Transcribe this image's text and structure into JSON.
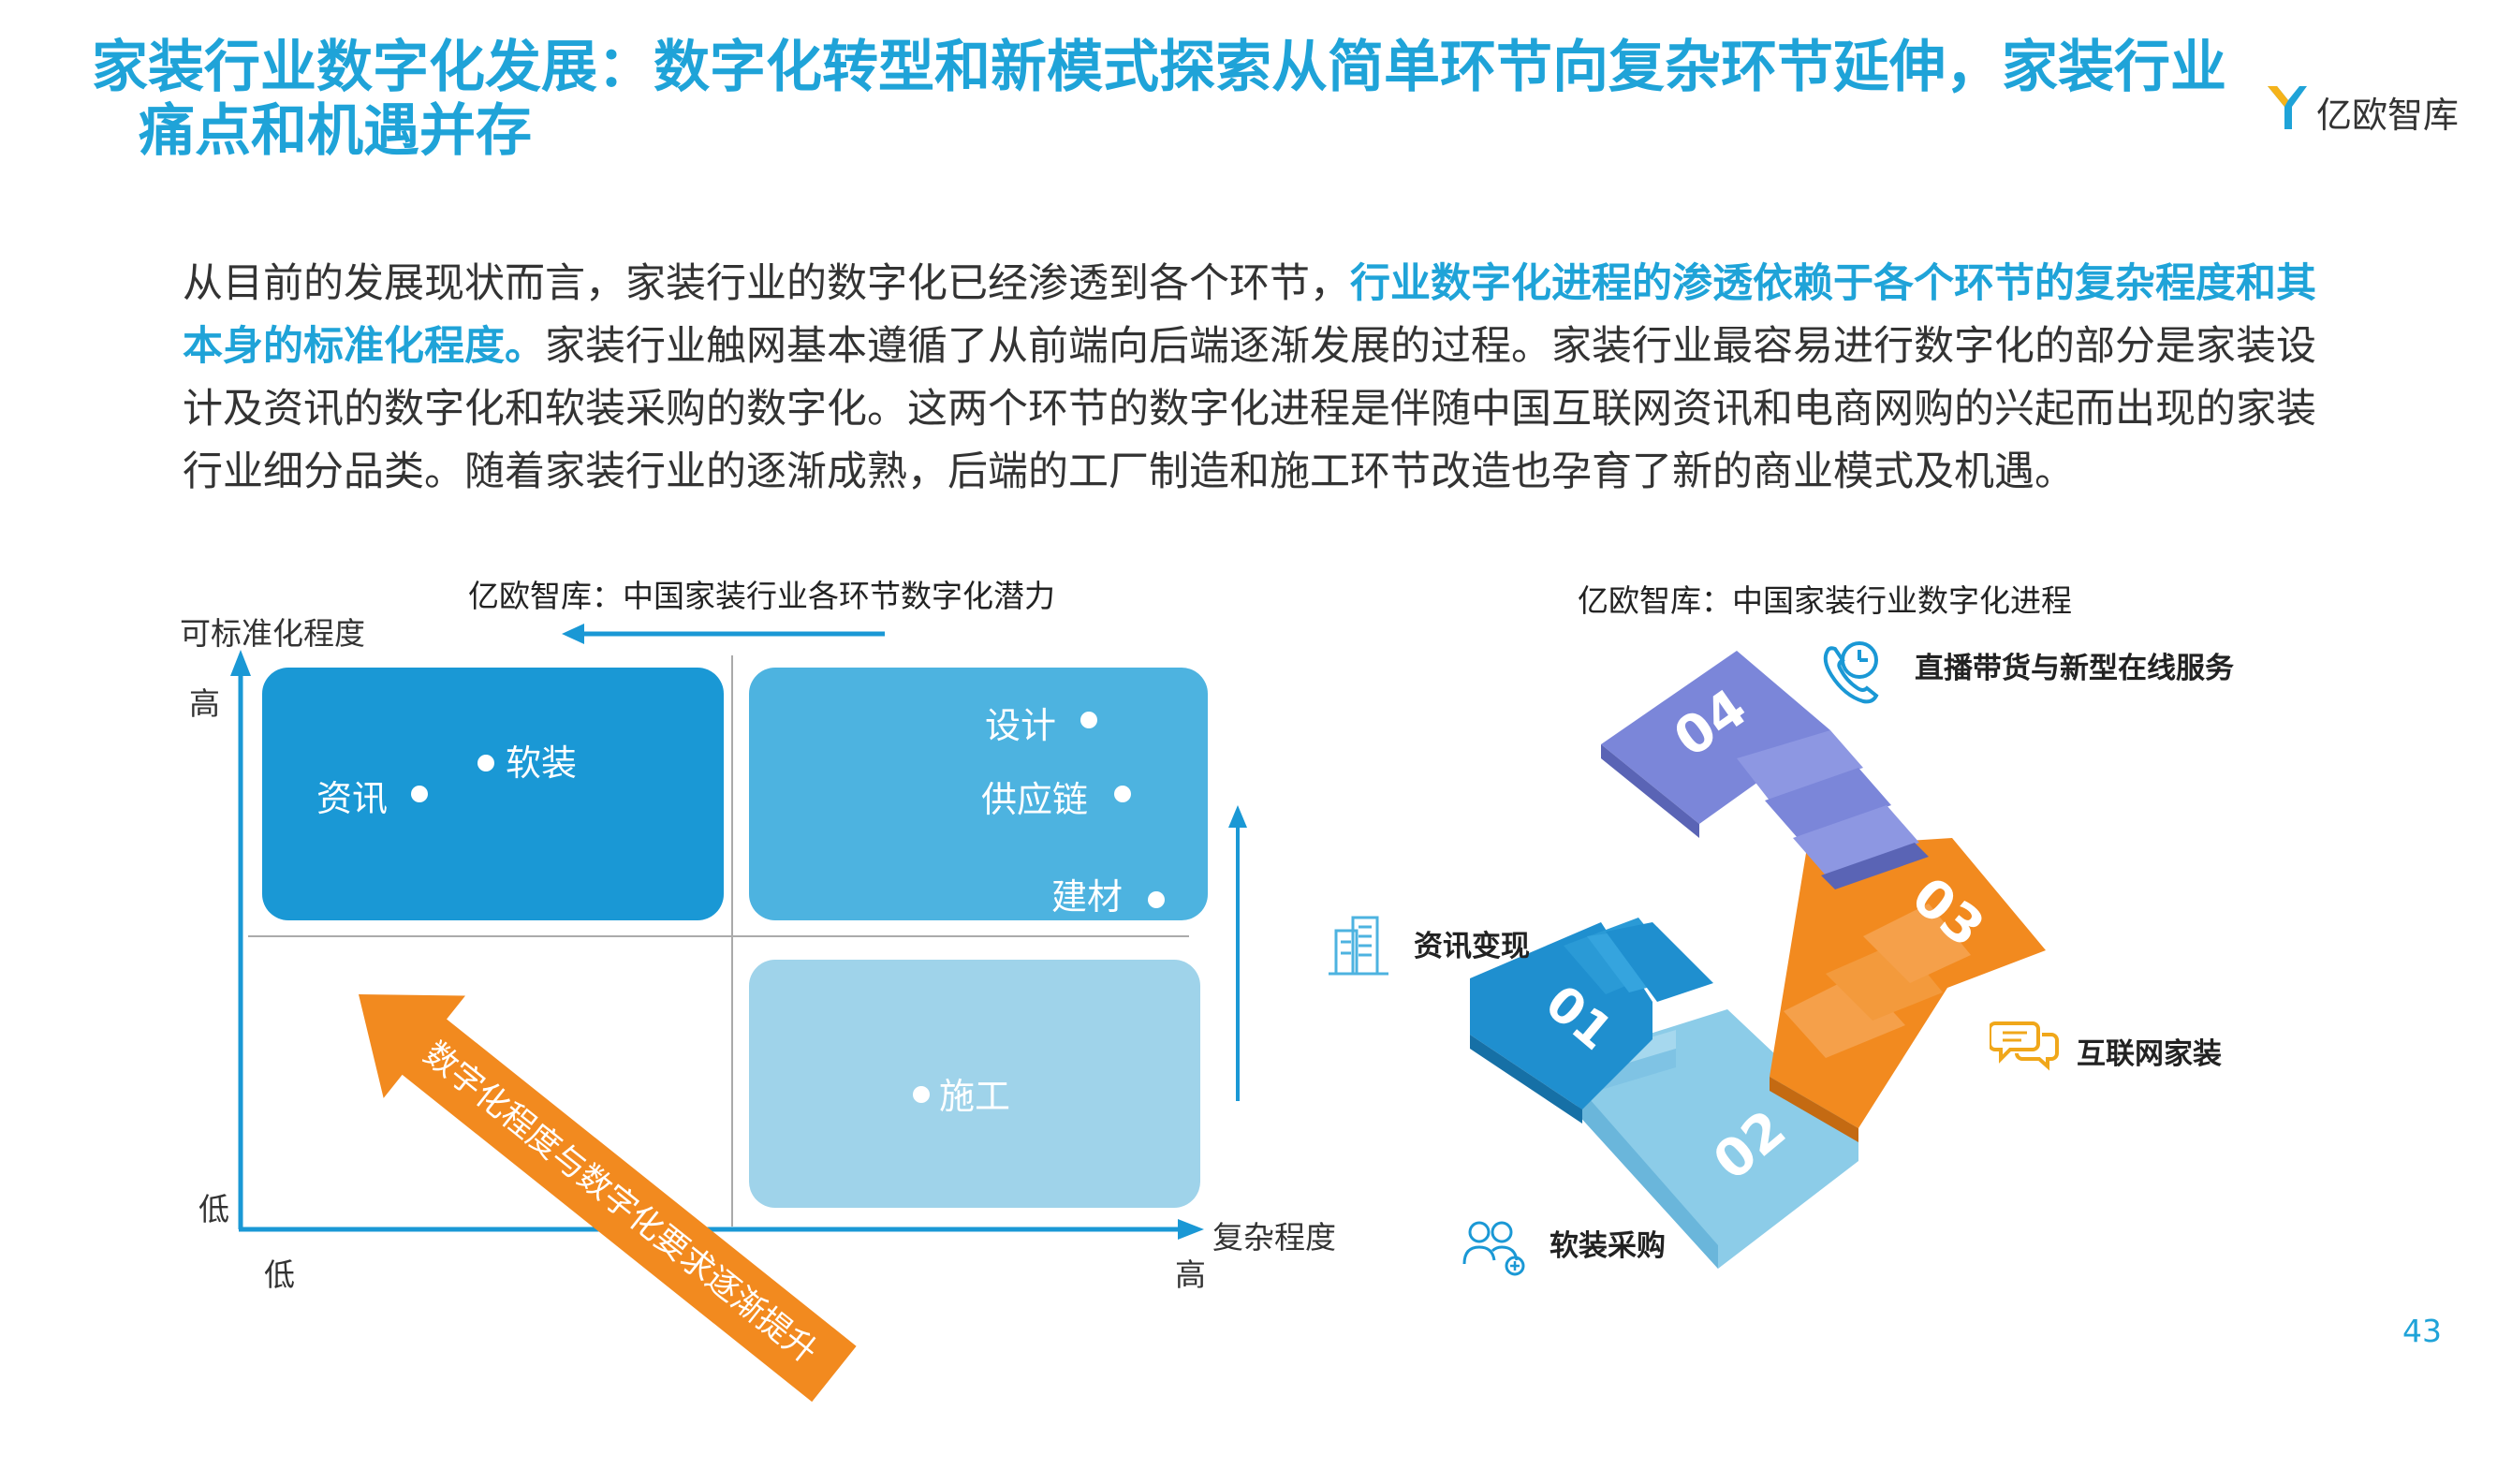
{
  "header": {
    "title_line1": "家装行业数字化发展：数字化转型和新模式探索从简单环节向复杂环节延伸，家装行业",
    "title_line2": "痛点和机遇并存",
    "logo_text": "亿欧智库"
  },
  "intro": {
    "p1": "从目前的发展现状而言，家装行业的数字化已经渗透到各个环节，",
    "highlight": "行业数字化进程的渗透依赖于各个环节的复杂程度和其本身的标准化程度。",
    "p2": "家装行业触网基本遵循了从前端向后端逐渐发展的过程。家装行业最容易进行数字化的部分是家装设计及资讯的数字化和软装采购的数字化。这两个环节的数字化进程是伴随中国互联网资讯和电商网购的兴起而出现的家装行业细分品类。随着家装行业的逐渐成熟，后端的工厂制造和施工环节改造也孕育了新的商业模式及机遇。"
  },
  "left_chart": {
    "title": "亿欧智库：中国家装行业各环节数字化潜力",
    "y_axis": "可标准化程度",
    "x_axis": "复杂程度",
    "y_high": "高",
    "y_low": "低",
    "x_low": "低",
    "x_high": "高",
    "arrow_text": "数字化程度与数字化要求逐渐提升",
    "items": {
      "zixun": "资讯",
      "ruanzhuang": "软装",
      "sheji": "设计",
      "gongyinglian": "供应链",
      "jiancai": "建材",
      "shigong": "施工"
    },
    "colors": {
      "q1": "#1a98d5",
      "q2": "#4db3e0",
      "q3": "#9fd3ea",
      "arrow": "#f28a1f",
      "axis": "#1a98d5"
    }
  },
  "right_chart": {
    "title": "亿欧智库：中国家装行业数字化进程",
    "steps": [
      {
        "num": "01",
        "label": "资讯变现",
        "color": "#1f8fcf",
        "icon": "building-icon"
      },
      {
        "num": "02",
        "label": "软装采购",
        "color": "#8ccce8",
        "icon": "users-icon"
      },
      {
        "num": "03",
        "label": "互联网家装",
        "color": "#f28a1f",
        "icon": "chat-icon"
      },
      {
        "num": "04",
        "label": "直播带货与新型在线服务",
        "color": "#7b86d9",
        "icon": "phone-clock-icon"
      }
    ]
  },
  "page_number": "43"
}
